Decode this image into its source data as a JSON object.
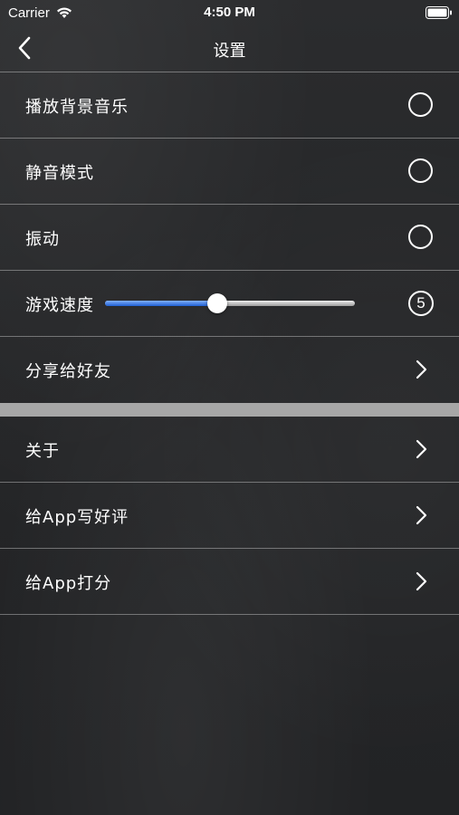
{
  "status_bar": {
    "carrier": "Carrier",
    "time": "4:50 PM"
  },
  "nav": {
    "title": "设置",
    "back_icon": "chevron-left-icon"
  },
  "settings": {
    "music_label": "播放背景音乐",
    "mute_label": "静音模式",
    "vibrate_label": "振动",
    "speed_label": "游戏速度",
    "speed_value": "5",
    "speed_slider_fraction": 0.45,
    "share_label": "分享给好友"
  },
  "about_section": {
    "about_label": "关于",
    "review_label": "给App写好评",
    "rate_label": "给App打分"
  },
  "colors": {
    "slider_fill": "#1f5fd0",
    "divider": "#a7a7a7",
    "background": "#252628"
  }
}
